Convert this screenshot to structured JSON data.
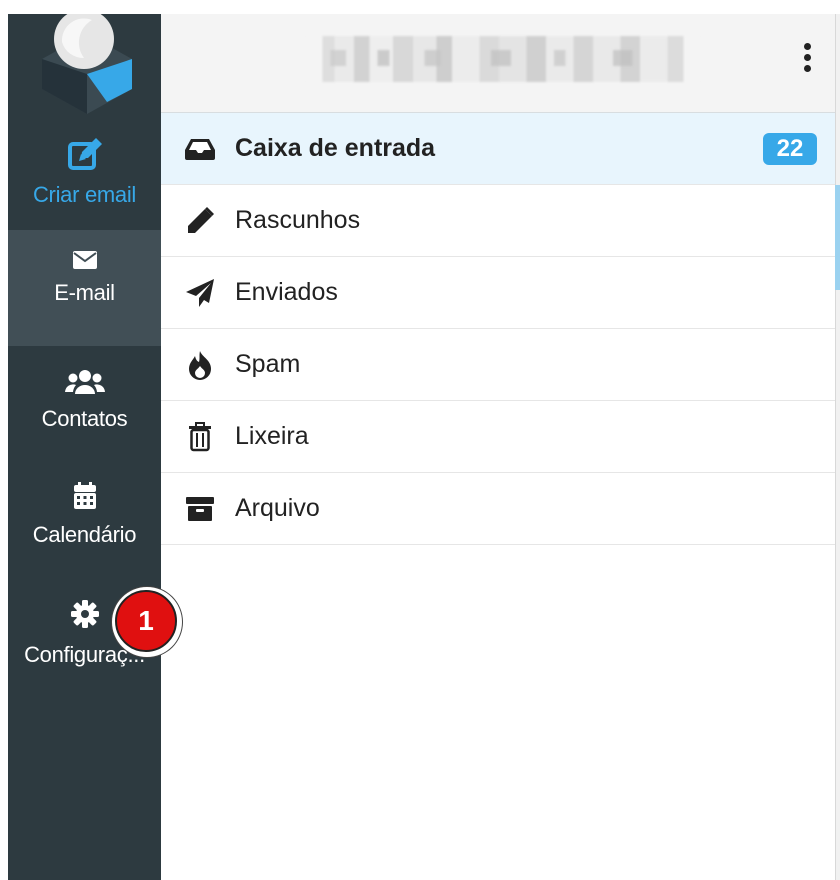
{
  "sidebar": {
    "compose_label": "Criar email",
    "items": [
      {
        "label": "E-mail",
        "icon": "envelope-icon"
      },
      {
        "label": "Contatos",
        "icon": "users-icon"
      },
      {
        "label": "Calendário",
        "icon": "calendar-icon"
      },
      {
        "label": "Configuraç...",
        "icon": "gear-icon"
      }
    ]
  },
  "annotation": {
    "marker": "1"
  },
  "header": {
    "menu_icon": "vertical-dots-icon"
  },
  "folders": [
    {
      "name": "Caixa de entrada",
      "icon": "inbox-icon",
      "count": "22"
    },
    {
      "name": "Rascunhos",
      "icon": "pencil-icon"
    },
    {
      "name": "Enviados",
      "icon": "paper-plane-icon"
    },
    {
      "name": "Spam",
      "icon": "fire-icon"
    },
    {
      "name": "Lixeira",
      "icon": "trash-icon"
    },
    {
      "name": "Arquivo",
      "icon": "archive-icon"
    }
  ],
  "colors": {
    "accent": "#37a8e8",
    "sidebar": "#2d3a40",
    "sidebar_active": "#414f56",
    "marker": "#e01010"
  }
}
